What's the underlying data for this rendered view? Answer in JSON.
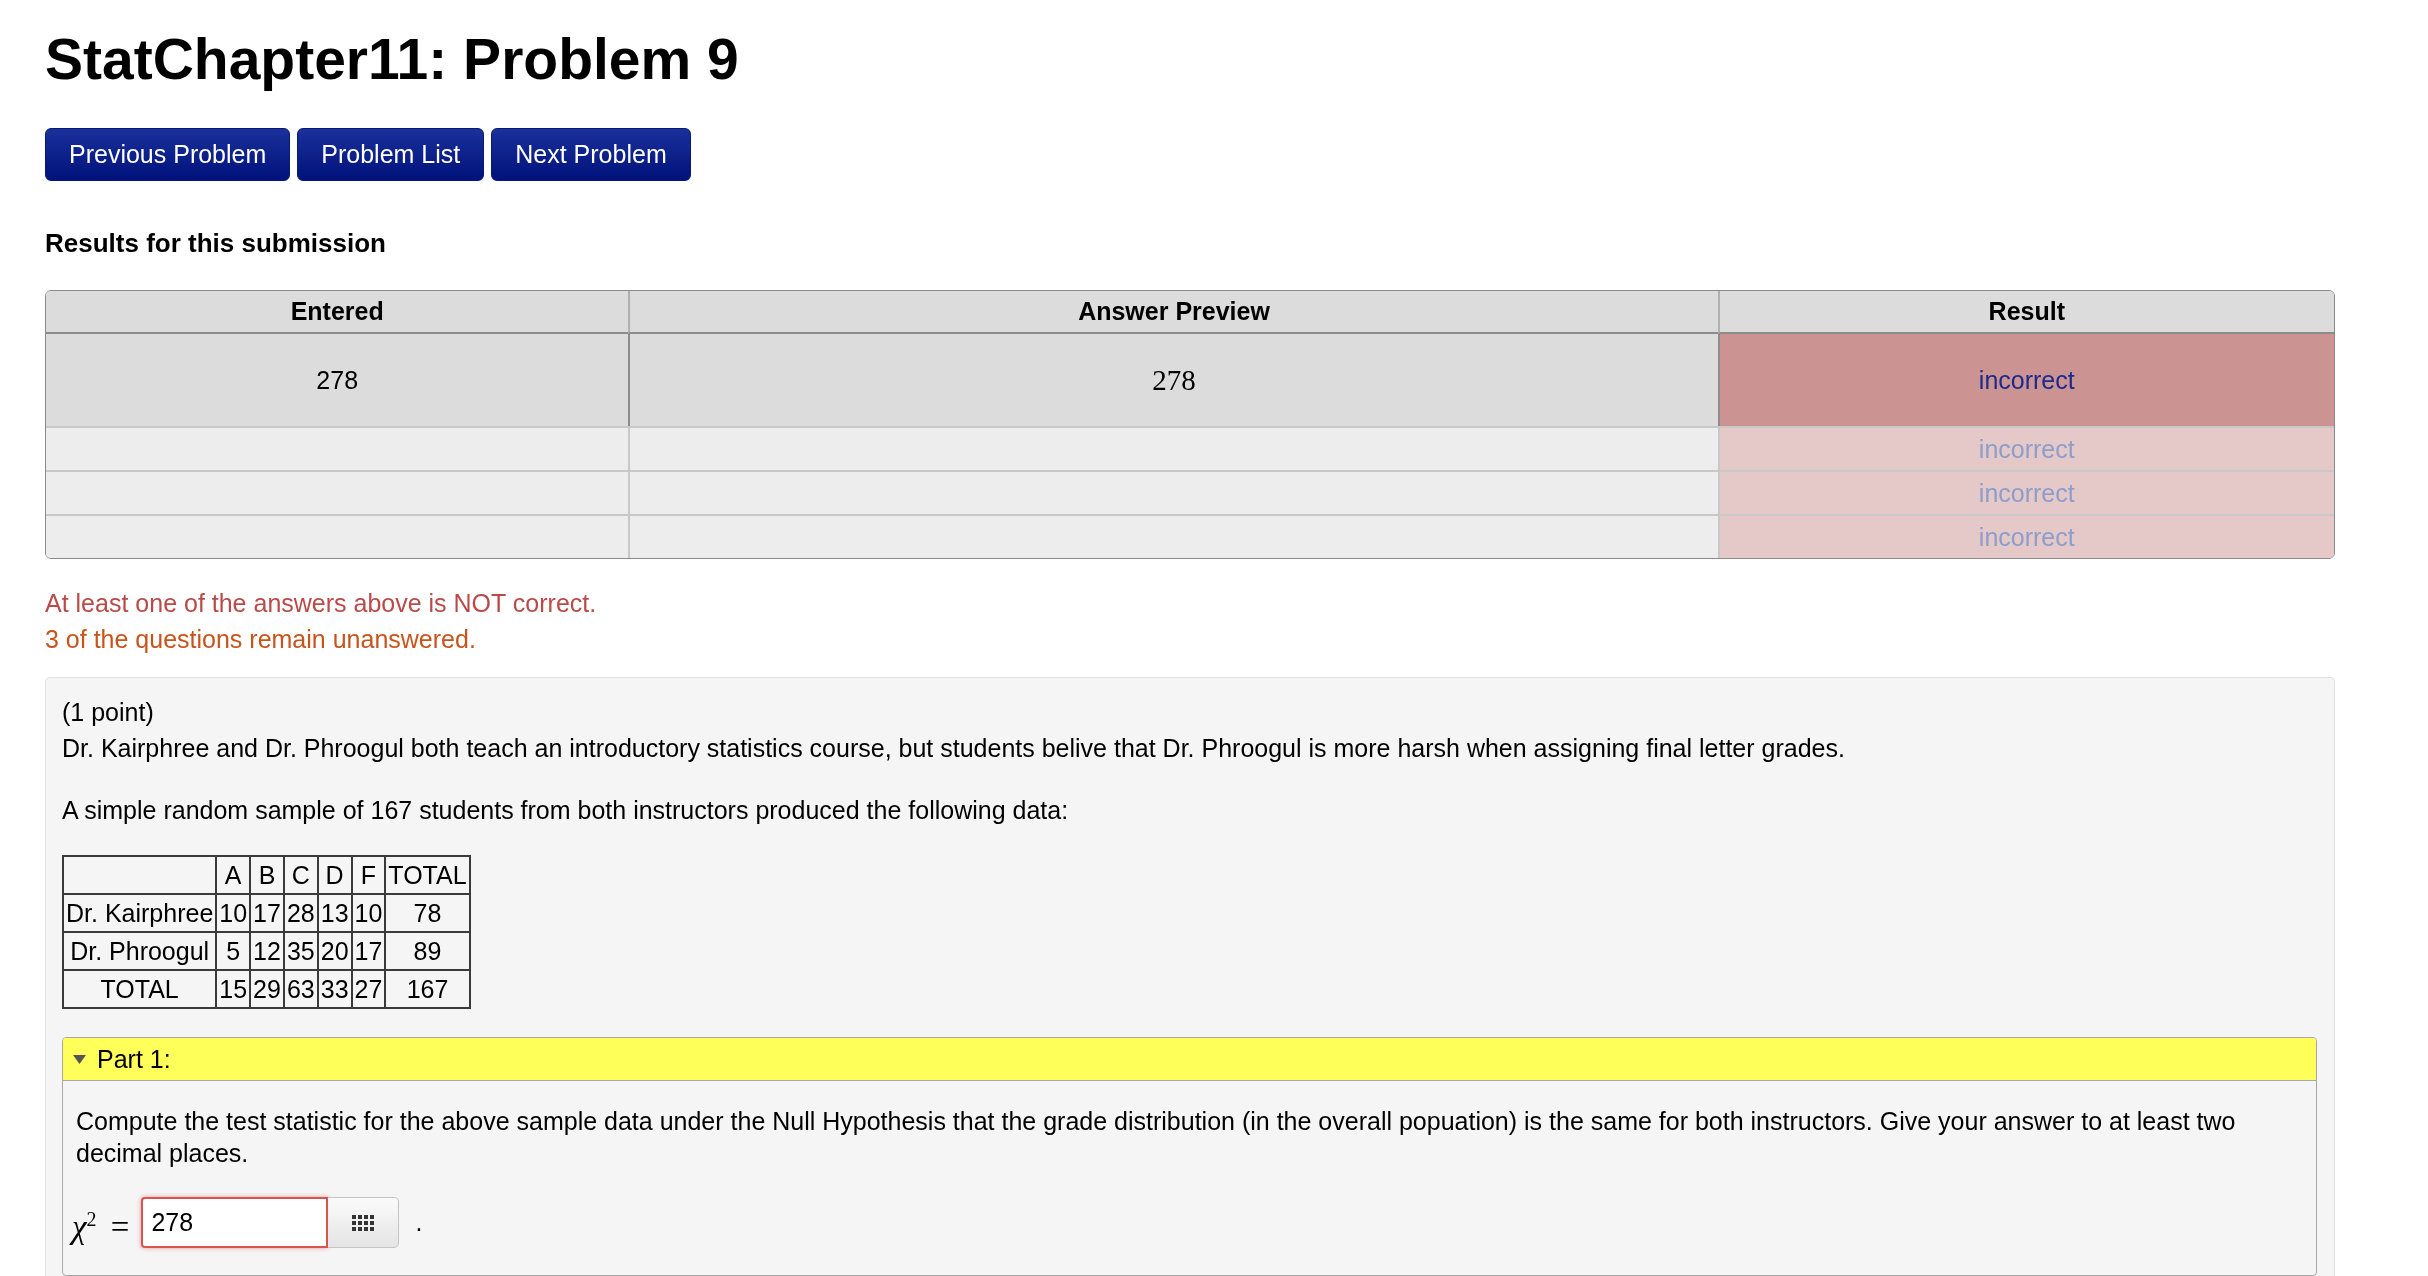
{
  "page": {
    "title": "StatChapter11: Problem 9"
  },
  "nav_buttons": [
    {
      "label": "Previous Problem"
    },
    {
      "label": "Problem List"
    },
    {
      "label": "Next Problem"
    }
  ],
  "results": {
    "heading": "Results for this submission",
    "columns": [
      "Entered",
      "Answer Preview",
      "Result"
    ],
    "rows": [
      {
        "entered": "278",
        "preview": "278",
        "result": "incorrect",
        "correct": false,
        "selected": true
      },
      {
        "result": "incorrect",
        "correct": false,
        "selected": false
      },
      {
        "result": "incorrect",
        "correct": false,
        "selected": false
      },
      {
        "result": "incorrect",
        "correct": false,
        "selected": false
      }
    ]
  },
  "messages": [
    {
      "kind": "error",
      "text": "At least one of the answers above is NOT correct."
    },
    {
      "kind": "warning",
      "text": "3 of the questions remain unanswered."
    }
  ],
  "problem": {
    "points": "(1 point)",
    "paragraphs": [
      "Dr. Kairphree and Dr. Phroogul both teach an introductory statistics course, but students belive that Dr. Phroogul is more harsh when assigning final letter grades.",
      "A simple random sample of 167 students from both instructors produced the following data:"
    ],
    "data_table": {
      "columns": [
        "A",
        "B",
        "C",
        "D",
        "F",
        "TOTAL"
      ],
      "rows": [
        {
          "label": "Dr. Kairphree",
          "cells": [
            "10",
            "17",
            "28",
            "13",
            "10",
            "78"
          ]
        },
        {
          "label": "Dr. Phroogul",
          "cells": [
            "5",
            "12",
            "35",
            "20",
            "17",
            "89"
          ]
        },
        {
          "label": "TOTAL",
          "cells": [
            "15",
            "29",
            "63",
            "33",
            "27",
            "167"
          ]
        }
      ]
    },
    "parts": [
      {
        "title": "Part 1:",
        "expanded": true,
        "prompt": "Compute the test statistic for the above sample data under the Null Hypothesis that the grade distribution (in the overall popuation) is the same for both instructors. Give your answer to at least two decimal places.",
        "answer": {
          "label": "*χ*$^{2}$ =",
          "value": "278",
          "correct": false,
          "suffix": "."
        }
      }
    ]
  }
}
